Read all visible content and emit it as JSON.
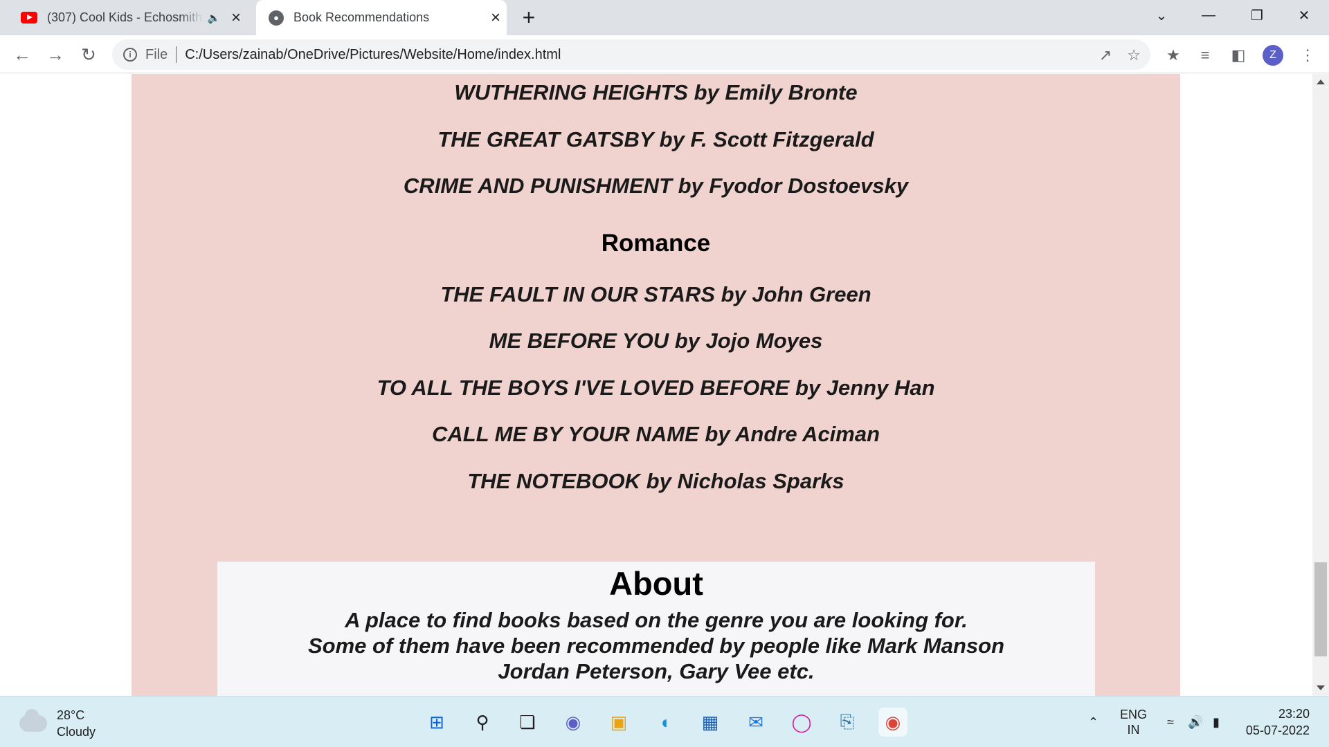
{
  "browser": {
    "tabs": [
      {
        "title": "(307) Cool Kids - Echosmith (",
        "icon": "youtube-icon",
        "active": false,
        "audio": true
      },
      {
        "title": "Book Recommendations",
        "icon": "globe-icon",
        "active": true
      }
    ],
    "new_tab": "+",
    "address": {
      "scheme_label": "File",
      "url": "C:/Users/zainab/OneDrive/Pictures/Website/Home/index.html"
    },
    "profile_initial": "Z"
  },
  "page": {
    "classics": [
      "WUTHERING HEIGHTS by Emily Bronte",
      "THE GREAT GATSBY by F. Scott Fitzgerald",
      "CRIME AND PUNISHMENT by Fyodor Dostoevsky"
    ],
    "romance_heading": "Romance",
    "romance": [
      "THE FAULT IN OUR STARS by John Green",
      "ME BEFORE YOU by Jojo Moyes",
      "TO ALL THE BOYS I'VE LOVED BEFORE by Jenny Han",
      "CALL ME BY YOUR NAME by Andre Aciman",
      "THE NOTEBOOK by Nicholas Sparks"
    ],
    "about": {
      "heading": "About",
      "lines": [
        "A place to find books based on the genre you are looking for.",
        "Some of them have been recommended by people like Mark Manson",
        "Jordan Peterson, Gary Vee etc."
      ]
    }
  },
  "taskbar": {
    "weather": {
      "temp": "28°C",
      "condition": "Cloudy"
    },
    "language": {
      "line1": "ENG",
      "line2": "IN"
    },
    "clock": {
      "time": "23:20",
      "date": "05-07-2022"
    }
  },
  "colors": {
    "page_background": "#f0d3cf",
    "about_background": "#f6f5f7",
    "tabstrip": "#dee1e6",
    "taskbar": "#d9edf4"
  }
}
